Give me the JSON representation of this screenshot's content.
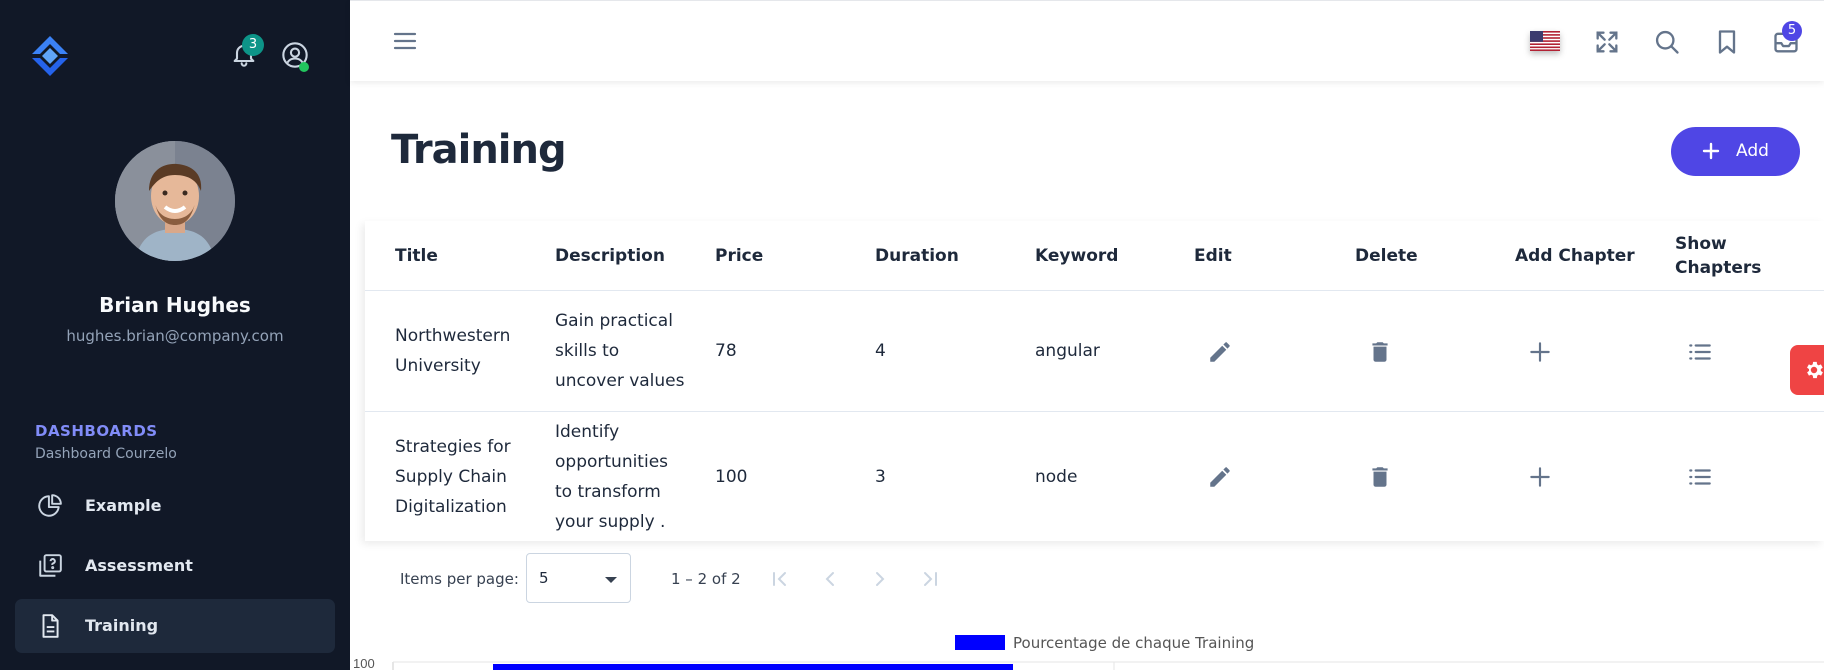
{
  "header": {
    "notifications_count": "3",
    "messages_count": "5",
    "language": "en-US"
  },
  "user": {
    "name": "Brian Hughes",
    "email": "hughes.brian@company.com",
    "status": "online"
  },
  "sidebar": {
    "group_title": "DASHBOARDS",
    "group_subtitle": "Dashboard Courzelo",
    "items": [
      {
        "label": "Example",
        "icon": "chart-pie-icon",
        "active": false
      },
      {
        "label": "Assessment",
        "icon": "question-stack-icon",
        "active": false
      },
      {
        "label": "Training",
        "icon": "document-icon",
        "active": true
      }
    ]
  },
  "page": {
    "title": "Training",
    "add_label": "Add"
  },
  "table": {
    "columns": [
      "Title",
      "Description",
      "Price",
      "Duration",
      "Keyword",
      "Edit",
      "Delete",
      "Add Chapter",
      "Show Chapters"
    ],
    "rows": [
      {
        "title": "Northwestern University",
        "description": "Gain practical skills to uncover values",
        "price": "78",
        "duration": "4",
        "keyword": "angular"
      },
      {
        "title": "Strategies for Supply Chain Digitalization",
        "description": "Identify opportunities to transform your supply .",
        "price": "100",
        "duration": "3",
        "keyword": "node"
      }
    ]
  },
  "paginator": {
    "items_per_page_label": "Items per page:",
    "items_per_page_value": "5",
    "range_label": "1 – 2 of 2"
  },
  "chart_data": {
    "type": "bar",
    "series": [
      {
        "name": "Pourcentage de chaque Training",
        "color": "#0000ff"
      }
    ],
    "y_visible_tick": "100"
  },
  "colors": {
    "sidebar_bg": "#111827",
    "accent": "#4f46e5",
    "badge_teal": "#0d9488",
    "settings_tab": "#ef4444"
  }
}
